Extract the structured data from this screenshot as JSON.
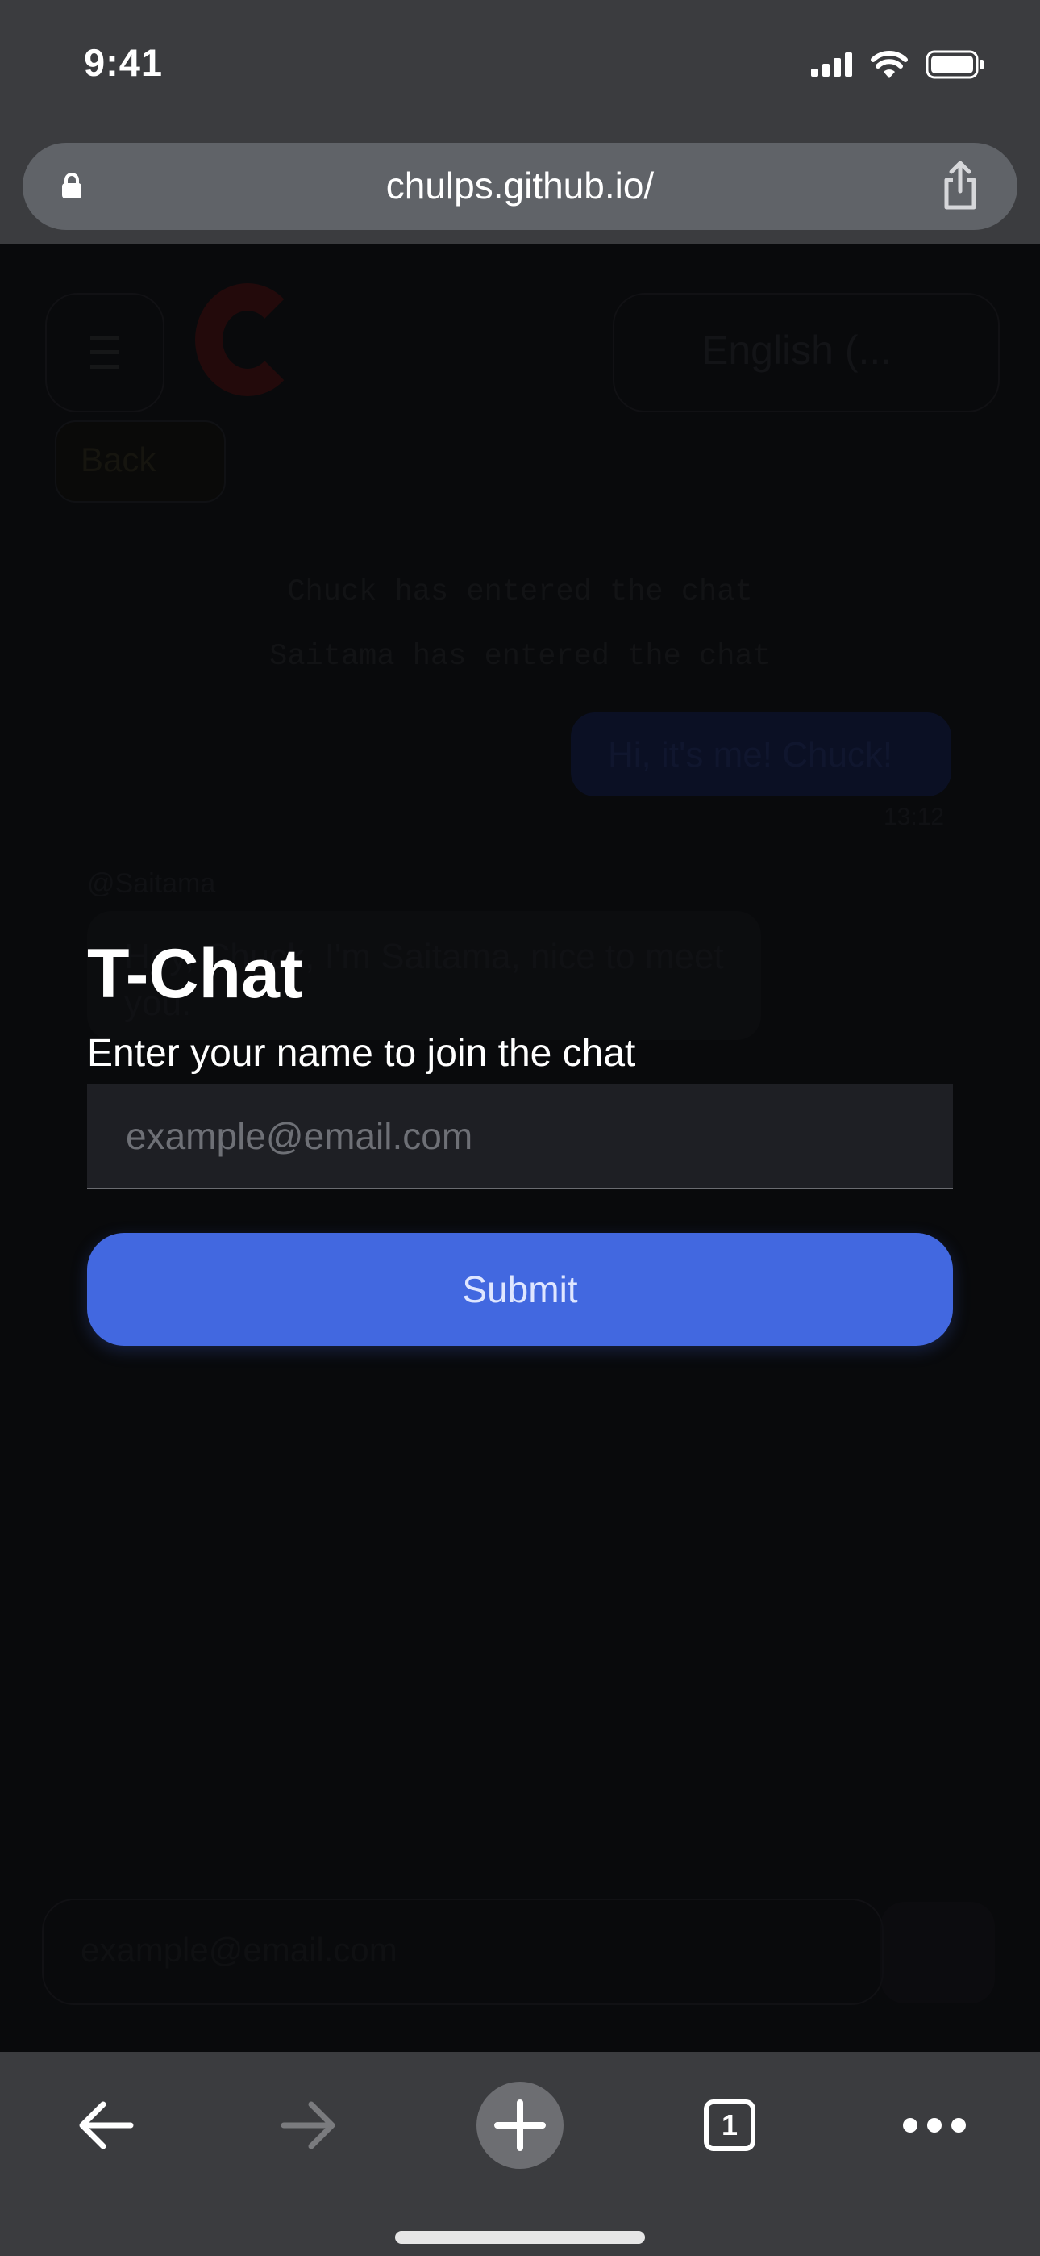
{
  "status_bar": {
    "time": "9:41"
  },
  "browser": {
    "url": "chulps.github.io/"
  },
  "background_page": {
    "language_label": "English (...",
    "back_label": "Back",
    "system_messages": [
      "Chuck has entered the chat",
      "Saitama has entered the chat"
    ],
    "own_message": {
      "text": "Hi, it's me! Chuck!",
      "time": "13:12"
    },
    "other_message": {
      "user": "@Saitama",
      "text": "Hey, Chuck, I'm Saitama, nice to meet you."
    },
    "input_placeholder": "example@email.com"
  },
  "form": {
    "title": "T-Chat",
    "subtitle": "Enter your name to join the chat",
    "input_placeholder": "example@email.com",
    "submit_label": "Submit"
  },
  "toolbar": {
    "tab_count": "1"
  },
  "colors": {
    "accent": "#4268e0",
    "chrome": "#3b3c3f",
    "background": "#050608"
  }
}
